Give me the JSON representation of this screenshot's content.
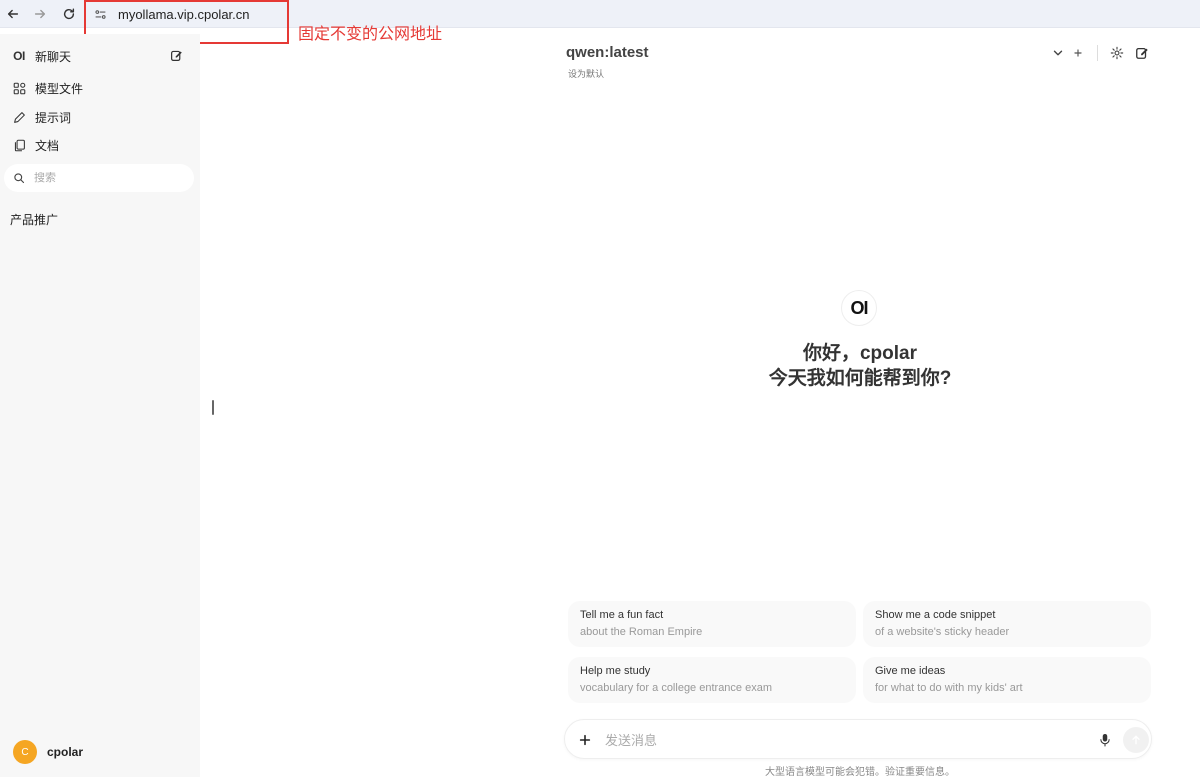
{
  "browser": {
    "url": "myollama.vip.cpolar.cn",
    "annotation": "固定不变的公网地址"
  },
  "sidebar": {
    "logo": "OI",
    "new_chat": "新聊天",
    "items": [
      {
        "label": "模型文件",
        "icon": "model-files-icon"
      },
      {
        "label": "提示词",
        "icon": "pencil-icon"
      },
      {
        "label": "文档",
        "icon": "documents-icon"
      }
    ],
    "search_placeholder": "搜索",
    "section_label": "产品推广",
    "user": {
      "avatar_letter": "C",
      "name": "cpolar",
      "avatar_color": "#f5a623"
    }
  },
  "header": {
    "model": "qwen:latest",
    "set_default": "设为默认"
  },
  "welcome": {
    "logo": "OI",
    "line1": "你好，cpolar",
    "line2": "今天我如何能帮到你?"
  },
  "suggestions": [
    {
      "title": "Tell me a fun fact",
      "subtitle": "about the Roman Empire"
    },
    {
      "title": "Show me a code snippet",
      "subtitle": "of a website's sticky header"
    },
    {
      "title": "Help me study",
      "subtitle": "vocabulary for a college entrance exam"
    },
    {
      "title": "Give me ideas",
      "subtitle": "for what to do with my kids' art"
    }
  ],
  "input": {
    "placeholder": "发送消息",
    "disclaimer": "大型语言模型可能会犯错。验证重要信息。"
  },
  "colors": {
    "annotation": "#e53935",
    "sidebar_bg": "#f7f7f7",
    "avatar": "#f5a623"
  }
}
